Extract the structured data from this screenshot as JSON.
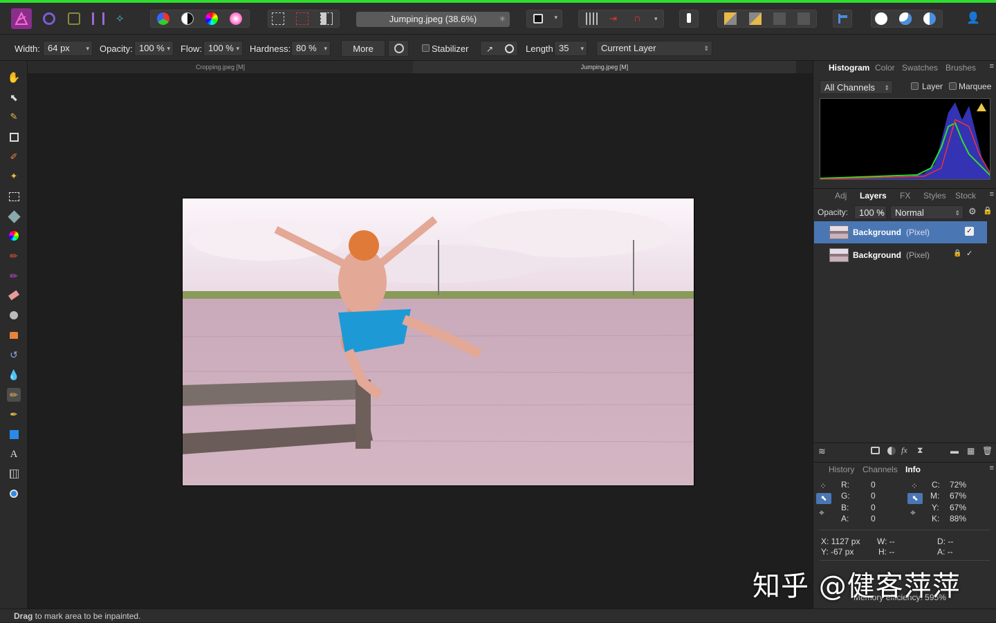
{
  "document": {
    "title": "Jumping.jpeg (38.6%)",
    "tabs": [
      "Cropping.jpeg [M]",
      "Jumping.jpeg [M]"
    ]
  },
  "context_toolbar": {
    "width_label": "Width:",
    "width_value": "64 px",
    "opacity_label": "Opacity:",
    "opacity_value": "100 %",
    "flow_label": "Flow:",
    "flow_value": "100 %",
    "hardness_label": "Hardness:",
    "hardness_value": "80 %",
    "more_label": "More",
    "stabilizer_label": "Stabilizer",
    "length_label": "Length:",
    "length_value": "35",
    "source_value": "Current Layer"
  },
  "top_panel": {
    "tabs": [
      "Histogram",
      "Color",
      "Swatches",
      "Brushes"
    ],
    "active_tab": "Histogram",
    "channels_value": "All Channels",
    "layer_label": "Layer",
    "marquee_label": "Marquee"
  },
  "layers_panel": {
    "tabs": [
      "Adj",
      "Layers",
      "FX",
      "Styles",
      "Stock"
    ],
    "active_tab": "Layers",
    "opacity_label": "Opacity:",
    "opacity_value": "100 %",
    "blend_mode": "Normal",
    "layers": [
      {
        "name": "Background",
        "type": "(Pixel)",
        "selected": true
      },
      {
        "name": "Background",
        "type": "(Pixel)",
        "selected": false
      }
    ]
  },
  "info_panel": {
    "tabs": [
      "History",
      "Channels",
      "Info"
    ],
    "active_tab": "Info",
    "rgba": {
      "r_label": "R:",
      "r": "0",
      "g_label": "G:",
      "g": "0",
      "b_label": "B:",
      "b": "0",
      "a_label": "A:",
      "a": "0"
    },
    "cmyk": {
      "c_label": "C:",
      "c": "72%",
      "m_label": "M:",
      "m": "67%",
      "y_label": "Y:",
      "y": "67%",
      "k_label": "K:",
      "k": "88%"
    },
    "x": "X: 1127 px",
    "y": "Y: -67 px",
    "w": "W: --",
    "h": "H: --",
    "d": "D: --",
    "a": "A: --",
    "memory": "Memory efficiency: 595%"
  },
  "status": {
    "bold": "Drag",
    "text": " to mark area to be inpainted."
  },
  "watermark": "知乎 @健客萍萍",
  "colors": {
    "accent": "#4a7bbd",
    "selected_layer": "#4a77b4",
    "green_bar": "#2ede2e"
  }
}
